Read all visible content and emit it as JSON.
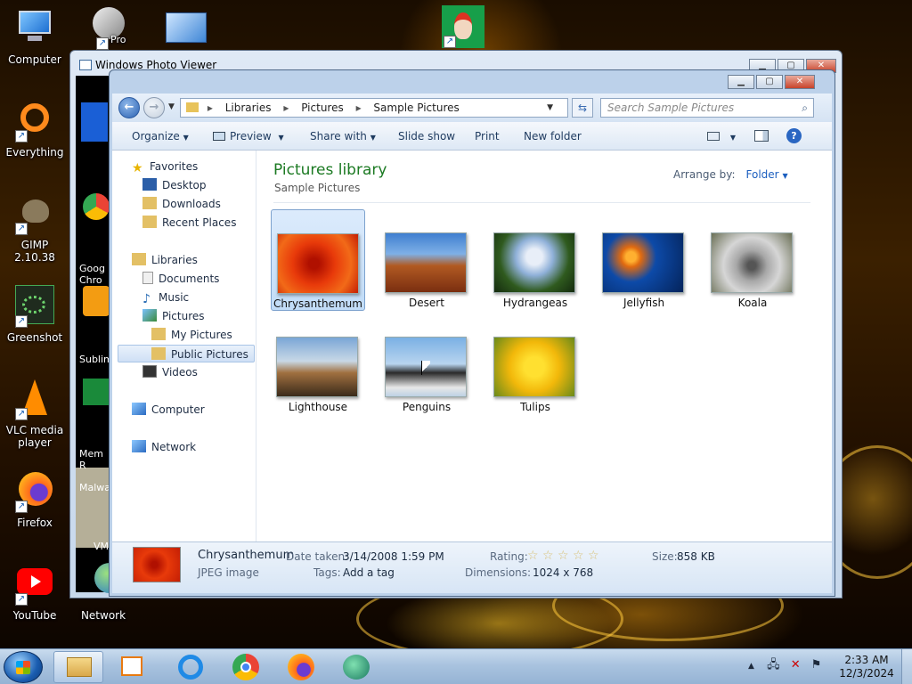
{
  "desktop": {
    "icons_left": [
      {
        "label": "Computer",
        "icon": "computer-icon"
      },
      {
        "label": "Everything",
        "icon": "everything-icon"
      },
      {
        "label": "GIMP 2.10.38",
        "icon": "gimp-icon"
      },
      {
        "label": "Greenshot",
        "icon": "greenshot-icon"
      },
      {
        "label": "VLC media player",
        "icon": "vlc-icon"
      },
      {
        "label": "Firefox",
        "icon": "firefox-icon"
      },
      {
        "label": "YouTube",
        "icon": "youtube-icon"
      }
    ],
    "icons_second": [
      {
        "label": "Pro",
        "icon": "pro-icon"
      },
      {
        "label": "Malware",
        "icon": "malwarebytes-icon"
      },
      {
        "label": "Goog Chro",
        "icon": "chrome-icon"
      },
      {
        "label": "Sublim",
        "icon": "sublime-icon"
      },
      {
        "label": "Mem R",
        "icon": "memory-icon"
      },
      {
        "label": "VM",
        "icon": "folder-icon"
      },
      {
        "label": "Network",
        "icon": "network-icon"
      }
    ]
  },
  "photo_viewer": {
    "title": "Windows Photo Viewer"
  },
  "explorer": {
    "breadcrumb": [
      "Libraries",
      "Pictures",
      "Sample Pictures"
    ],
    "search_placeholder": "Search Sample Pictures",
    "toolbar": {
      "organize": "Organize",
      "preview": "Preview",
      "share_with": "Share with",
      "slide_show": "Slide show",
      "print": "Print",
      "new_folder": "New folder"
    },
    "nav": {
      "favorites": "Favorites",
      "desktop": "Desktop",
      "downloads": "Downloads",
      "recent_places": "Recent Places",
      "libraries": "Libraries",
      "documents": "Documents",
      "music": "Music",
      "pictures": "Pictures",
      "my_pictures": "My Pictures",
      "public_pictures": "Public Pictures",
      "videos": "Videos",
      "computer": "Computer",
      "network": "Network"
    },
    "library_title": "Pictures library",
    "library_subtitle": "Sample Pictures",
    "arrange_label": "Arrange by:",
    "arrange_value": "Folder",
    "files": [
      {
        "name": "Chrysanthemum",
        "selected": true
      },
      {
        "name": "Desert",
        "selected": false
      },
      {
        "name": "Hydrangeas",
        "selected": false
      },
      {
        "name": "Jellyfish",
        "selected": false
      },
      {
        "name": "Koala",
        "selected": false
      },
      {
        "name": "Lighthouse",
        "selected": false
      },
      {
        "name": "Penguins",
        "selected": false
      },
      {
        "name": "Tulips",
        "selected": false
      }
    ],
    "details": {
      "name": "Chrysanthemum",
      "type": "JPEG image",
      "date_taken_label": "Date taken:",
      "date_taken": "3/14/2008 1:59 PM",
      "tags_label": "Tags:",
      "tags": "Add a tag",
      "rating_label": "Rating:",
      "rating_stars": 0,
      "dimensions_label": "Dimensions:",
      "dimensions": "1024 x 768",
      "size_label": "Size:",
      "size": "858 KB"
    }
  },
  "taskbar": {
    "clock_time": "2:33 AM",
    "clock_date": "12/3/2024"
  }
}
